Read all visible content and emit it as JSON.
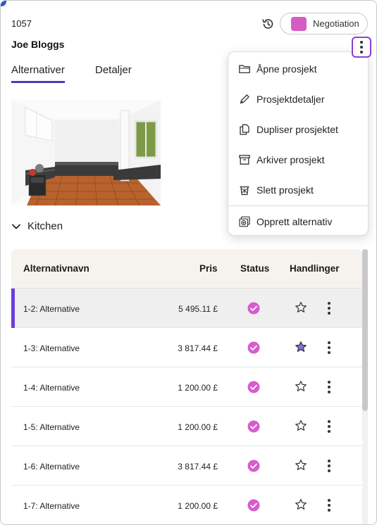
{
  "project": {
    "id": "1057",
    "name": "Joe Bloggs"
  },
  "status": {
    "label": "Negotiation",
    "color": "#d65cc4"
  },
  "tabs": [
    {
      "label": "Alternativer",
      "active": true
    },
    {
      "label": "Detaljer",
      "active": false
    }
  ],
  "section": {
    "label": "Kitchen"
  },
  "table": {
    "headers": {
      "name": "Alternativnavn",
      "price": "Pris",
      "status": "Status",
      "actions": "Handlinger"
    },
    "rows": [
      {
        "name": "1-2: Alternative",
        "price": "5 495.11 £",
        "favorite": false,
        "selected": true
      },
      {
        "name": "1-3: Alternative",
        "price": "3 817.44 £",
        "favorite": true,
        "selected": false
      },
      {
        "name": "1-4: Alternative",
        "price": "1 200.00 £",
        "favorite": false,
        "selected": false
      },
      {
        "name": "1-5: Alternative",
        "price": "1 200.00 £",
        "favorite": false,
        "selected": false
      },
      {
        "name": "1-6: Alternative",
        "price": "3 817.44 £",
        "favorite": false,
        "selected": false
      },
      {
        "name": "1-7: Alternative",
        "price": "1 200.00 £",
        "favorite": false,
        "selected": false
      }
    ]
  },
  "menu": {
    "items": [
      {
        "label": "Åpne prosjekt",
        "icon": "folder-icon"
      },
      {
        "label": "Prosjektdetaljer",
        "icon": "pen-icon"
      },
      {
        "label": "Dupliser prosjektet",
        "icon": "duplicate-icon"
      },
      {
        "label": "Arkiver prosjekt",
        "icon": "archive-icon"
      },
      {
        "label": "Slett prosjekt",
        "icon": "trash-icon"
      },
      {
        "label": "Opprett alternativ",
        "icon": "add-alternative-icon"
      }
    ]
  },
  "colors": {
    "accent": "#6b3fd8",
    "status_check": "#d65cd0",
    "star_filled": "#8a6fe0",
    "kebab_highlight": "#8b3fd8"
  }
}
